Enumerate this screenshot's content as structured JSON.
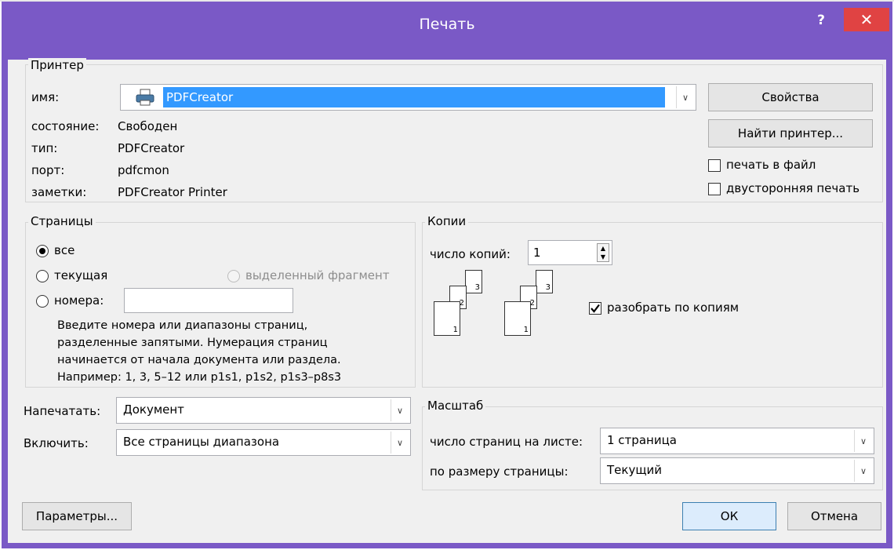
{
  "window": {
    "title": "Печать",
    "help_label": "?",
    "close_label": "✕"
  },
  "printer": {
    "group_label": "Принтер",
    "name_label": "имя:",
    "name_value": "PDFCreator",
    "status_label": "состояние:",
    "status_value": "Свободен",
    "type_label": "тип:",
    "type_value": "PDFCreator",
    "port_label": "порт:",
    "port_value": "pdfcmon",
    "notes_label": "заметки:",
    "notes_value": "PDFCreator Printer",
    "properties_button": "Свойства",
    "find_printer_button": "Найти принтер...",
    "print_to_file_label": "печать в файл",
    "duplex_label": "двусторонняя печать"
  },
  "pages": {
    "group_label": "Страницы",
    "all_label": "все",
    "current_label": "текущая",
    "selection_label": "выделенный фрагмент",
    "numbers_label": "номера:",
    "numbers_value": "",
    "hint_line1": "Введите номера или диапазоны страниц,",
    "hint_line2": "разделенные запятыми. Нумерация страниц",
    "hint_line3": "начинается от начала документа или раздела.",
    "hint_line4": "Например: 1, 3, 5–12 или p1s1, p1s2, p1s3–p8s3"
  },
  "copies": {
    "group_label": "Копии",
    "count_label": "число копий:",
    "count_value": "1",
    "collate_label": "разобрать по копиям",
    "collate_checked": true,
    "page_numbers": [
      "1",
      "2",
      "3"
    ]
  },
  "print_what": {
    "label": "Напечатать:",
    "value": "Документ"
  },
  "include": {
    "label": "Включить:",
    "value": "Все страницы диапазона"
  },
  "zoom": {
    "group_label": "Масштаб",
    "pages_per_sheet_label": "число страниц на листе:",
    "pages_per_sheet_value": "1 страница",
    "scale_label": "по размеру страницы:",
    "scale_value": "Текущий"
  },
  "footer": {
    "options_button": "Параметры...",
    "ok_button": "ОК",
    "cancel_button": "Отмена"
  }
}
